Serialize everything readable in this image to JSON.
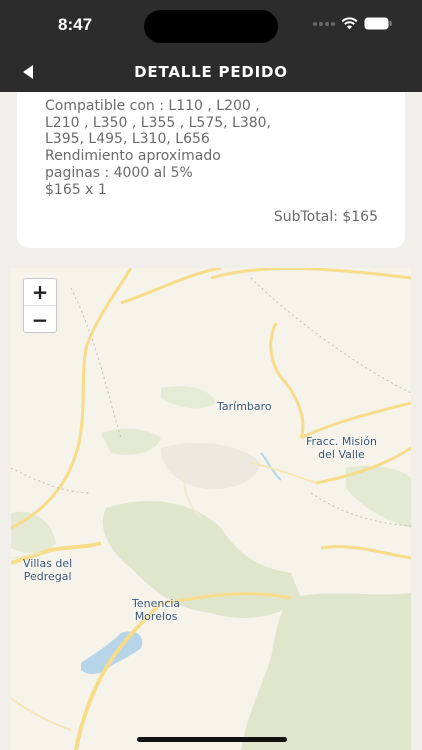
{
  "status_bar": {
    "time": "8:47",
    "icons": [
      "cellular-dots-icon",
      "wifi-icon",
      "battery-icon"
    ]
  },
  "header": {
    "title": "DETALLE PEDIDO",
    "back_icon": "back-arrow-icon",
    "background": "#2c2c2c"
  },
  "order_item": {
    "description_lines": [
      "Compatible con : L110 , L200 ,",
      "L210 , L350 , L355 , L575, L380,",
      "L395, L495, L310, L656",
      "Rendimiento aproximado",
      "paginas : 4000 al 5%",
      "$165 x 1"
    ],
    "subtotal": "SubTotal: $165"
  },
  "map": {
    "zoom_in": "+",
    "zoom_out": "−",
    "places": {
      "tarimbaro": "Tarímbaro",
      "mision_line1": "Fracc. Misión",
      "mision_line2": "del Valle",
      "villas_line1": "Villas del",
      "villas_line2": "Pedregal",
      "tenencia_line1": "Tenencia",
      "tenencia_line2": "Morelos"
    },
    "colors": {
      "land": "#f6f3eb",
      "green": "#dfe6cc",
      "road": "#f7dc8a",
      "water": "#b6d5e8"
    }
  }
}
